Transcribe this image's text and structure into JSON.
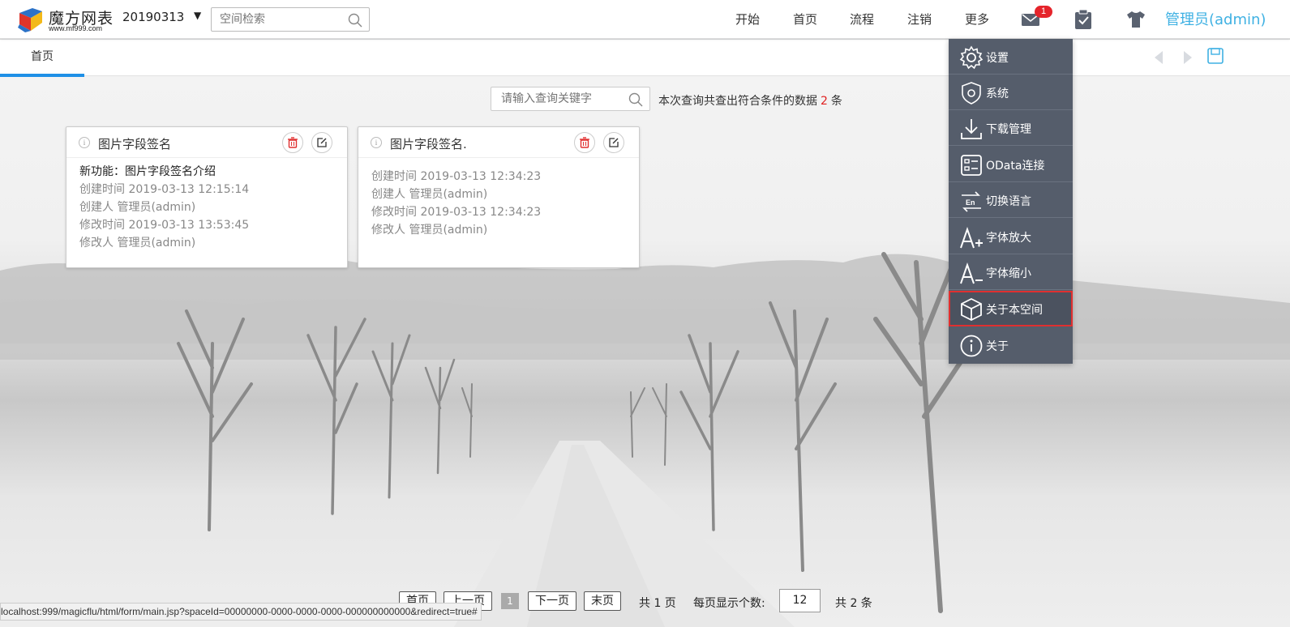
{
  "header": {
    "brand": "魔方网表",
    "brand_url": "www.mf999.com",
    "space_name": "20190313",
    "space_caret": "▼",
    "search_placeholder": "空间检索",
    "nav": [
      "开始",
      "首页",
      "流程",
      "注销",
      "更多"
    ],
    "mail_badge": "1",
    "user": "管理员(admin)"
  },
  "tabs": {
    "home": "首页"
  },
  "query": {
    "placeholder": "请输入查询关键字",
    "result_prefix": "本次查询共查出符合条件的数据",
    "result_count": "2",
    "result_suffix": "条"
  },
  "cards": [
    {
      "title": "图片字段签名",
      "desc": "新功能：图片字段签名介绍",
      "lines": [
        "创建时间 2019-03-13 12:15:14",
        "创建人 管理员(admin)",
        "修改时间 2019-03-13 13:53:45",
        "修改人 管理员(admin)"
      ]
    },
    {
      "title": "图片字段签名.",
      "desc": "",
      "lines": [
        "创建时间 2019-03-13 12:34:23",
        "创建人 管理员(admin)",
        "修改时间 2019-03-13 12:34:23",
        "修改人 管理员(admin)"
      ]
    }
  ],
  "menu": {
    "items": [
      "设置",
      "系统",
      "下载管理",
      "OData连接",
      "切换语言",
      "字体放大",
      "字体缩小",
      "关于本空间",
      "关于"
    ],
    "highlighted": "关于本空间"
  },
  "pager": {
    "first": "首页",
    "prev": "上一页",
    "current": "1",
    "next": "下一页",
    "last": "末页",
    "total_pages": "共 1 页",
    "per_page_label": "每页显示个数:",
    "per_page": "12",
    "total_items": "共 2 条"
  },
  "status_url": "localhost:999/magicflu/html/form/main.jsp?spaceId=00000000-0000-0000-0000-000000000000&redirect=true#",
  "colors": {
    "accent": "#3fb1e3",
    "tab_underline": "#1e90e6",
    "menu_bg": "#555d6b",
    "highlight_border": "#e03030",
    "badge": "#e5242b"
  }
}
